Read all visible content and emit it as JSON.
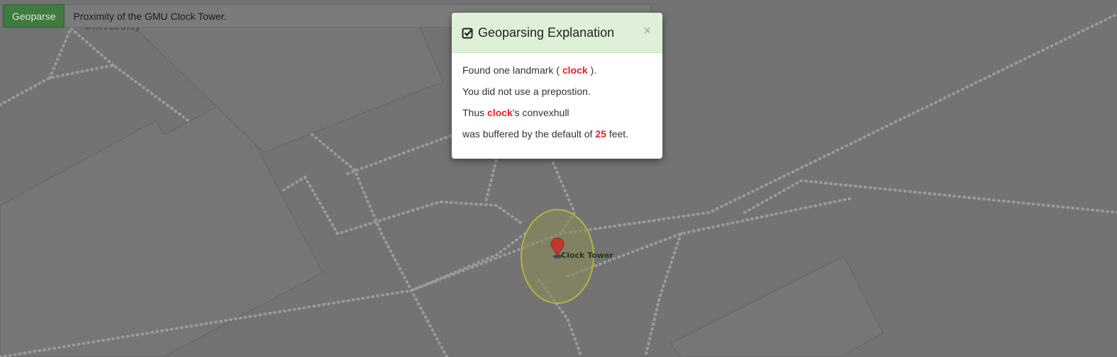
{
  "toolbar": {
    "geoparse_label": "Geoparse",
    "query_value": "Proximity of the GMU Clock Tower."
  },
  "map": {
    "label_university": "University",
    "label_clock_tower": "Clock Tower",
    "buffer_color": "#b5b53a",
    "marker_color": "#c0392b"
  },
  "modal": {
    "title": "Geoparsing Explanation",
    "close": "×",
    "line1_prefix": "Found one landmark ( ",
    "line1_term": "clock",
    "line1_suffix": " ).",
    "line2": "You did not use a prepostion.",
    "line3_prefix": "Thus ",
    "line3_term": "clock",
    "line3_suffix": "'s convexhull",
    "line4_prefix": "was buffered by the default of ",
    "line4_value": "25",
    "line4_suffix": " feet."
  }
}
